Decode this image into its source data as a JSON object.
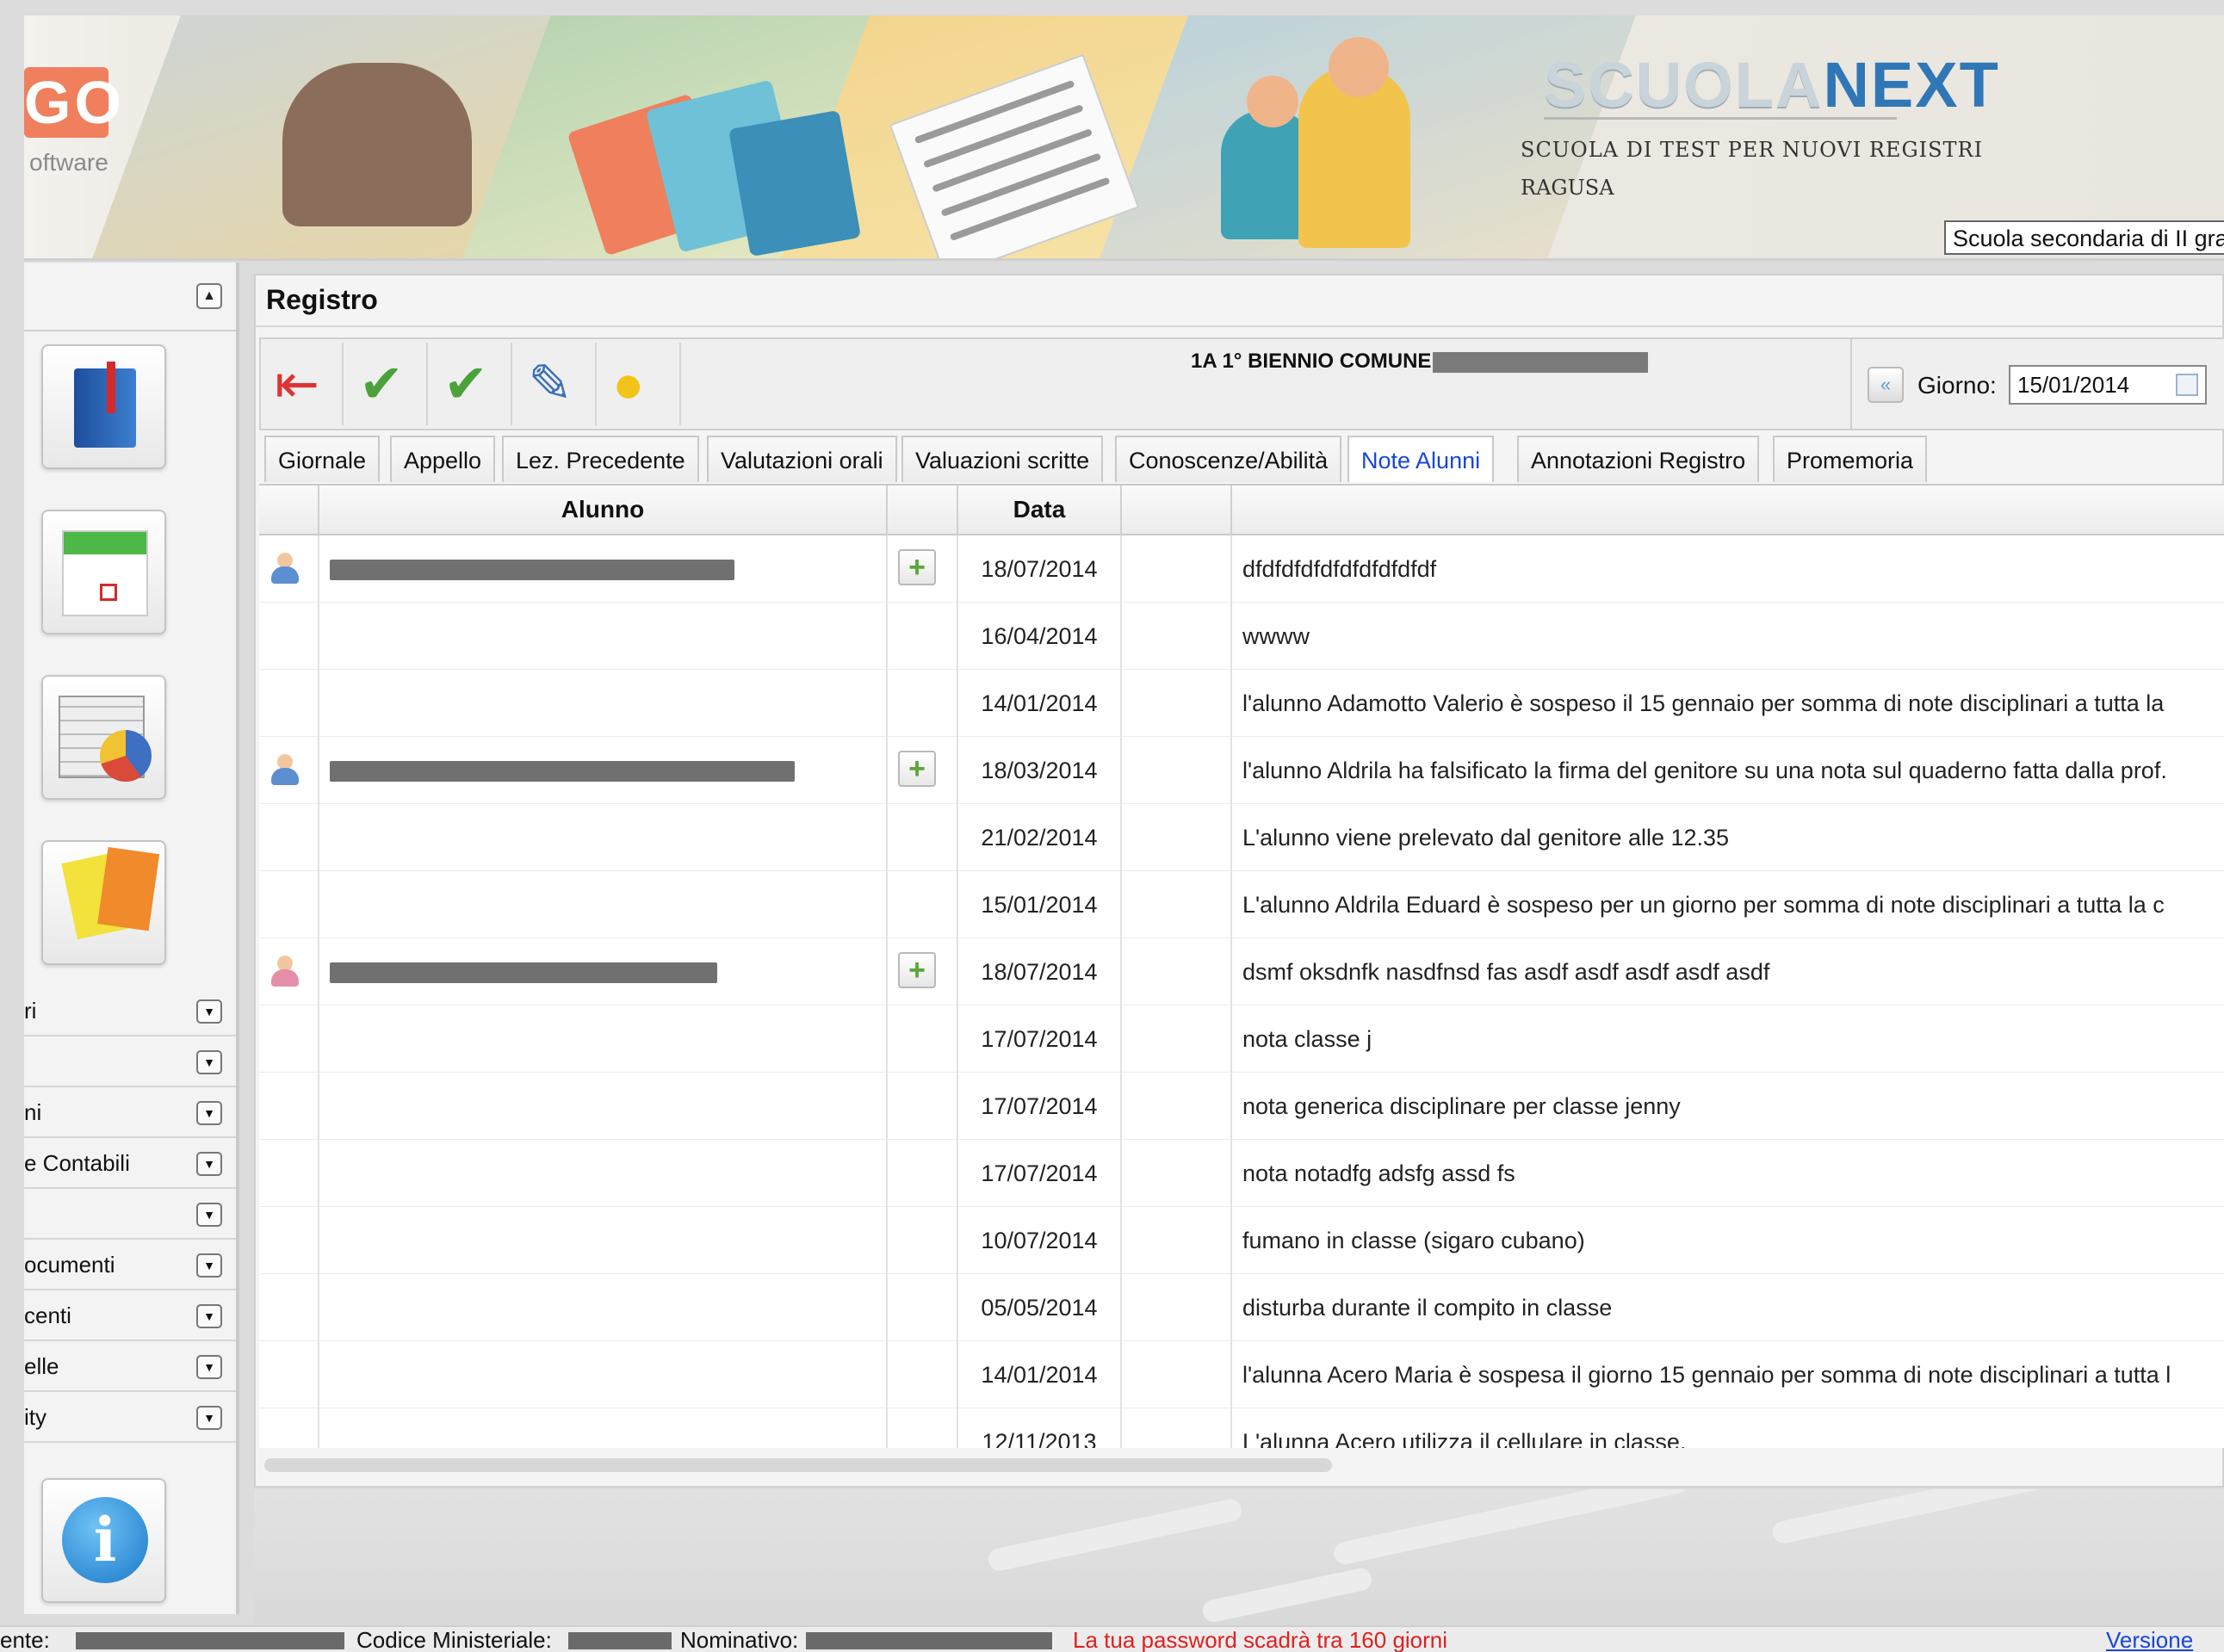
{
  "banner": {
    "logo_text": "GO",
    "logo_sub": "oftware",
    "brand_part1": "SCUOLA",
    "brand_part2": "NEXT",
    "school_name": "SCUOLA DI TEST PER NUOVI REGISTRI",
    "school_city": "RAGUSA",
    "school_type_selected": "Scuola secondaria di II grado"
  },
  "sidebar": {
    "collapse_symbol": "▲",
    "icons": [
      "register-book-icon",
      "calendar-icon",
      "spreadsheet-chart-icon",
      "cards-whistle-icon"
    ],
    "info_symbol": "i",
    "menu": [
      {
        "label": "ri"
      },
      {
        "label": ""
      },
      {
        "label": "ni"
      },
      {
        "label": "e Contabili"
      },
      {
        "label": ""
      },
      {
        "label": "ocumenti"
      },
      {
        "label": "centi"
      },
      {
        "label": "elle"
      },
      {
        "label": "ity"
      }
    ],
    "arrow_symbol": "▼"
  },
  "main": {
    "title": "Registro",
    "class_title": "1A 1° BIENNIO COMUNE",
    "toolbar_icons": [
      "exit-icon",
      "download-check-icon",
      "upload-check-icon",
      "edit-note-icon",
      "lightbulb-icon"
    ],
    "date_label": "Giorno:",
    "date_value": "15/01/2014",
    "tabs": [
      {
        "label": "Giornale"
      },
      {
        "label": "Appello"
      },
      {
        "label": "Lez. Precedente"
      },
      {
        "label": "Valutazioni orali"
      },
      {
        "label": "Valuazioni scritte"
      },
      {
        "label": "Conoscenze/Abilità"
      },
      {
        "label": "Note Alunni"
      },
      {
        "label": "Annotazioni Registro"
      },
      {
        "label": "Promemoria"
      }
    ],
    "active_tab": "Note Alunni",
    "columns": {
      "student": "Alunno",
      "date": "Data"
    },
    "rows": [
      {
        "date": "18/07/2014",
        "note": "dfdfdfdfdfdfdfdfdfdf"
      },
      {
        "date": "16/04/2014",
        "note": "wwww"
      },
      {
        "date": "14/01/2014",
        "note": "l'alunno Adamotto Valerio è sospeso il 15 gennaio per somma di note disciplinari a tutta la"
      },
      {
        "date": "18/03/2014",
        "note": "l'alunno Aldrila ha falsificato la firma del genitore su una nota sul quaderno fatta dalla prof."
      },
      {
        "date": "21/02/2014",
        "note": "L'alunno viene prelevato dal genitore alle 12.35"
      },
      {
        "date": "15/01/2014",
        "note": "L'alunno Aldrila Eduard è sospeso per un giorno per somma di note disciplinari a tutta la c"
      },
      {
        "date": "18/07/2014",
        "note": "dsmf oksdnfk nasdfnsd fas asdf asdf asdf asdf asdf"
      },
      {
        "date": "17/07/2014",
        "note": "nota classe j"
      },
      {
        "date": "17/07/2014",
        "note": "nota generica disciplinare per classe jenny"
      },
      {
        "date": "17/07/2014",
        "note": "nota notadfg adsfg assd fs"
      },
      {
        "date": "10/07/2014",
        "note": "fumano in classe (sigaro cubano)"
      },
      {
        "date": "05/05/2014",
        "note": "disturba durante il compito in classe"
      },
      {
        "date": "14/01/2014",
        "note": "l'alunna Acero Maria è sospesa il giorno 15 gennaio per somma di note disciplinari a tutta l"
      },
      {
        "date": "12/11/2013",
        "note": "L'alunna Acero utilizza il cellulare in classe."
      }
    ],
    "add_symbol": "+"
  },
  "status": {
    "user_label": "ente:",
    "ministerial_code_label": "Codice Ministeriale:",
    "name_label": "Nominativo:",
    "password_warning": "La tua password scadrà tra 160 giorni",
    "version_link": "Versione"
  },
  "colors": {
    "accent_blue": "#1a46d6",
    "warning_red": "#e02020",
    "brand_blue": "#2f77b6",
    "add_green": "#59a63a"
  }
}
